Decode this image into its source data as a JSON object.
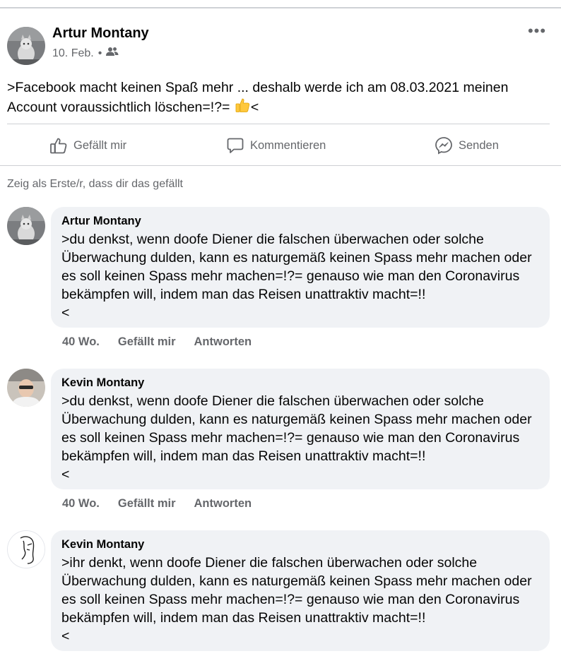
{
  "post": {
    "author": "Artur Montany",
    "date": "10. Feb.",
    "separator": "•",
    "privacy_icon": "friends-icon",
    "more_label": "•••",
    "text": ">Facebook macht keinen Spaß mehr ... deshalb werde ich am 08.03.2021 meinen Account voraussichtlich löschen=!?= ",
    "text_suffix": "<",
    "emoji": "thumbs-up-emoji"
  },
  "actions": {
    "like": "Gefällt mir",
    "comment": "Kommentieren",
    "send": "Senden"
  },
  "first_like_prompt": "Zeig als Erste/r, dass dir das gefällt",
  "comments": [
    {
      "author": "Artur Montany",
      "text": ">du denkst, wenn doofe Diener die falschen überwachen oder solche Überwachung dulden, kann es naturgemäß keinen Spass mehr machen oder es soll keinen Spass mehr machen=!?= genauso wie man den Coronavirus bekämpfen will, indem man das Reisen unattraktiv macht=!!\n<",
      "time": "40 Wo.",
      "like": "Gefällt mir",
      "reply": "Antworten"
    },
    {
      "author": "Kevin Montany",
      "text": ">du denkst, wenn doofe Diener die falschen überwachen oder solche Überwachung dulden, kann es naturgemäß keinen Spass mehr machen oder es soll keinen Spass mehr machen=!?= genauso wie man den Coronavirus bekämpfen will, indem man das Reisen unattraktiv macht=!!\n<",
      "time": "40 Wo.",
      "like": "Gefällt mir",
      "reply": "Antworten"
    },
    {
      "author": "Kevin Montany",
      "text": ">ihr denkt, wenn doofe Diener die falschen überwachen oder solche Überwachung dulden, kann es naturgemäß keinen Spass mehr machen oder es soll keinen Spass mehr machen=!?= genauso wie man den Coronavirus bekämpfen will, indem man das Reisen unattraktiv macht=!!\n<"
    }
  ]
}
